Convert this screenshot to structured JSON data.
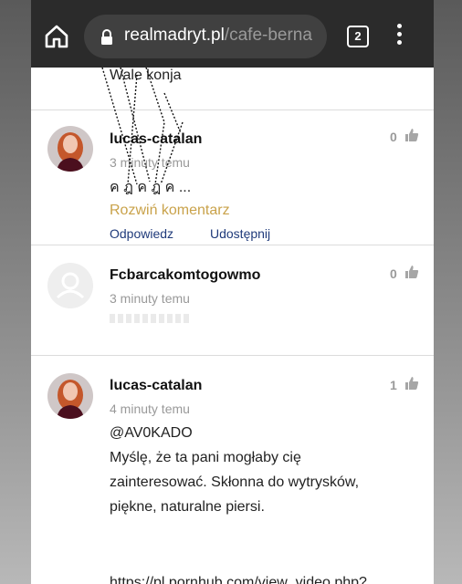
{
  "browser": {
    "url_domain": "realmadryt.pl",
    "url_path": "/cafe-berna",
    "tab_count": "2"
  },
  "fragment_text": "Wale konja",
  "comments": [
    {
      "author": "lucas-catalan",
      "time": "3 minuty temu",
      "body": "ค ฎ ค ฎ ค ...",
      "expand_label": "Rozwiń komentarz",
      "reply_label": "Odpowiedz",
      "share_label": "Udostępnij",
      "likes": "0"
    },
    {
      "author": "Fcbarcakomtogowmo",
      "time": "3 minuty temu",
      "likes": "0"
    },
    {
      "author": "lucas-catalan",
      "time": "4 minuty temu",
      "mention": "@AV0KADO",
      "body_lines": [
        "Myślę, że ta pani mogłaby cię",
        "zainteresować. Skłonna do wytrysków,",
        "piękne, naturalne piersi."
      ],
      "link": "https://pl.pornhub.com/view_video.php?",
      "likes": "1"
    }
  ]
}
